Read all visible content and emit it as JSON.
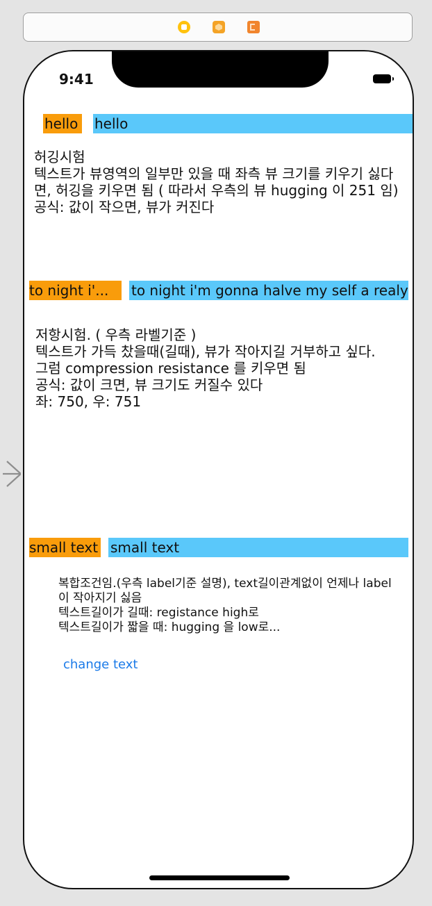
{
  "scene_dock": {
    "icons": [
      "view-controller-icon",
      "first-responder-icon",
      "exit-icon"
    ]
  },
  "status_bar": {
    "time": "9:41"
  },
  "row1": {
    "left_label": "hello",
    "right_label": "hello"
  },
  "para1": {
    "text": "허깅시험\n텍스트가 뷰영역의 일부만 있을 때 좌측 뷰 크기를 키우기 싫다면, 허깅을 키우면 됨 ( 따라서 우측의 뷰 hugging 이 251 임)\n공식: 값이 작으면, 뷰가 커진다"
  },
  "row2": {
    "left_label": "to night i'...",
    "right_label": "to night i'm gonna halve my self a realy"
  },
  "para2": {
    "text": "저항시험. ( 우측 라벨기준 )\n텍스트가 가득 찼을때(길때), 뷰가 작아지길 거부하고 싶다.\n그럼 compression resistance 를 키우면 됨\n공식: 값이 크면, 뷰 크기도 커질수 있다\n 좌: 750,  우: 751"
  },
  "row3": {
    "left_label": "small text",
    "right_label": "small text"
  },
  "para3": {
    "text": "복합조건임.(우측 label기준 설명), text길이관계없이 언제나 label이 작아지기 싫음\n텍스트길이가 길때: registance high로\n텍스트길이가 짧을 때: hugging 을 low로..."
  },
  "button": {
    "label": "change text"
  },
  "colors": {
    "orange": "#f99c0b",
    "blue": "#5ac8fa",
    "link": "#1a7ae8"
  }
}
